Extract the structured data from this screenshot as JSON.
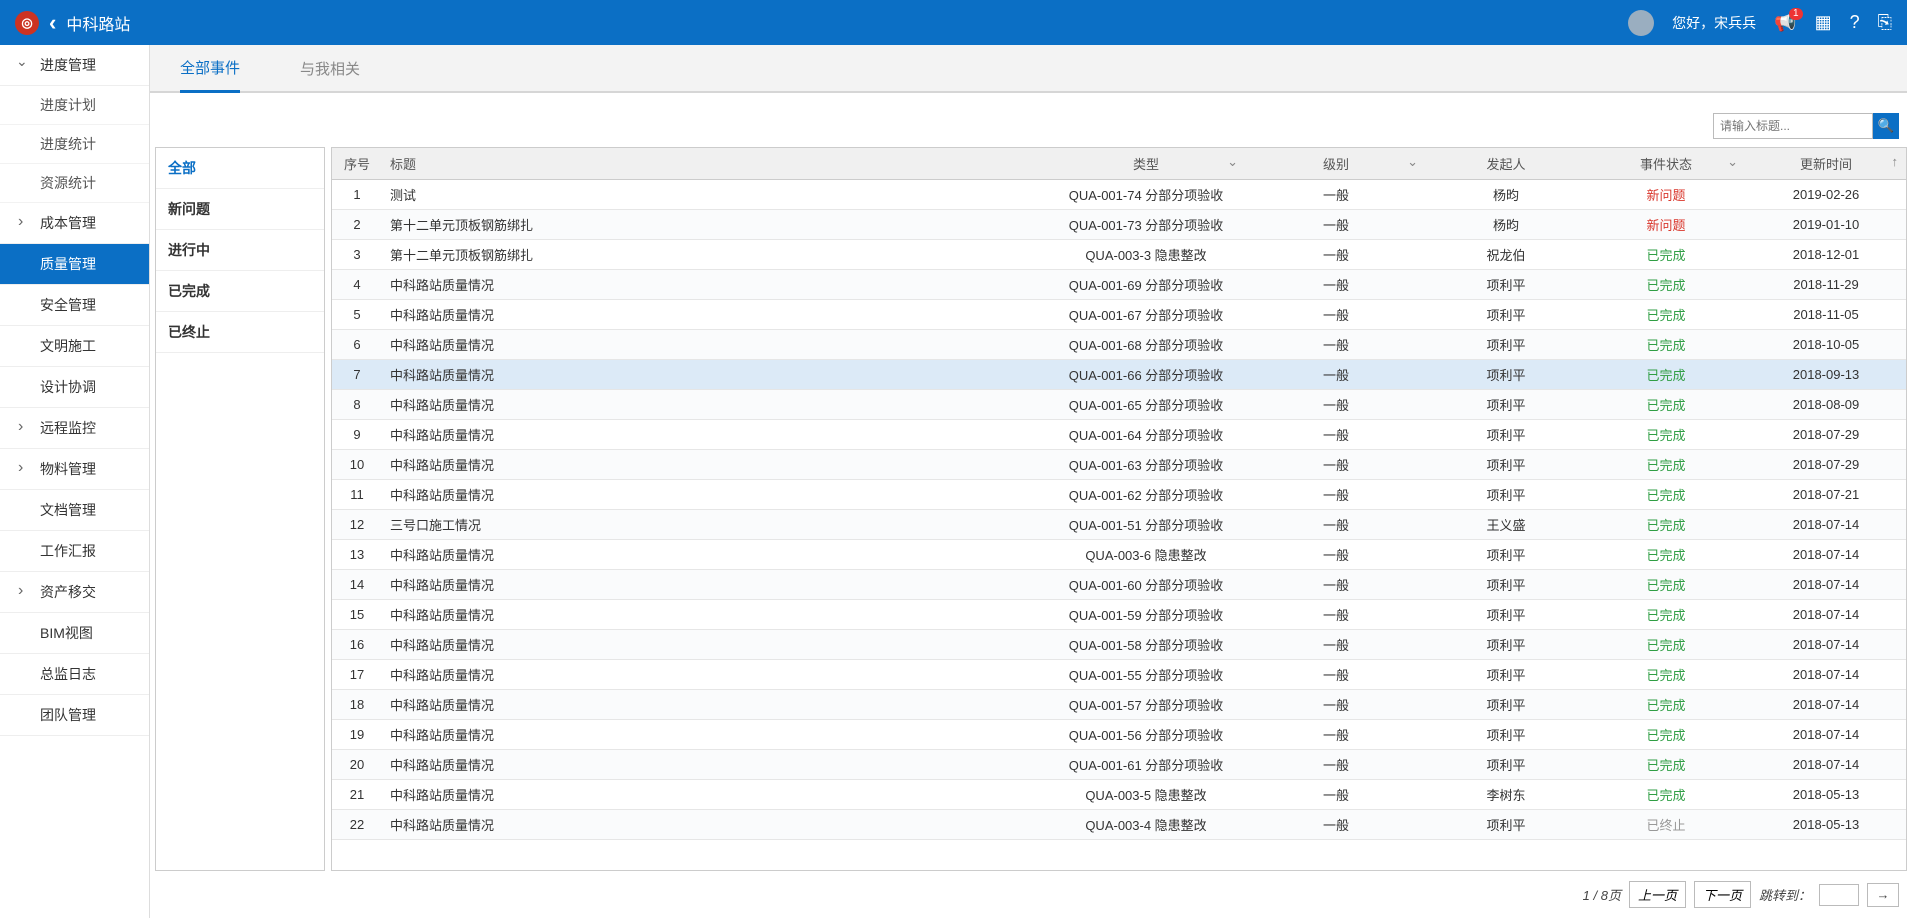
{
  "header": {
    "site_name": "中科路站",
    "greeting": "您好，宋兵兵",
    "badge_count": "1"
  },
  "sidebar": {
    "groups": [
      {
        "label": "进度管理",
        "expanded": true,
        "children": [
          {
            "label": "进度计划"
          },
          {
            "label": "进度统计"
          },
          {
            "label": "资源统计"
          }
        ]
      },
      {
        "label": "成本管理",
        "has_children": true
      },
      {
        "label": "质量管理",
        "active": true
      },
      {
        "label": "安全管理"
      },
      {
        "label": "文明施工"
      },
      {
        "label": "设计协调"
      },
      {
        "label": "远程监控",
        "has_children": true
      },
      {
        "label": "物料管理",
        "has_children": true
      },
      {
        "label": "文档管理"
      },
      {
        "label": "工作汇报"
      },
      {
        "label": "资产移交",
        "has_children": true
      },
      {
        "label": "BIM视图"
      },
      {
        "label": "总监日志"
      },
      {
        "label": "团队管理"
      }
    ]
  },
  "tabs": {
    "items": [
      {
        "label": "全部事件",
        "active": true
      },
      {
        "label": "与我相关"
      }
    ]
  },
  "search": {
    "placeholder": "请输入标题..."
  },
  "filters": {
    "items": [
      {
        "label": "全部",
        "active": true
      },
      {
        "label": "新问题"
      },
      {
        "label": "进行中"
      },
      {
        "label": "已完成"
      },
      {
        "label": "已终止"
      }
    ]
  },
  "table": {
    "headers": {
      "idx": "序号",
      "title": "标题",
      "type": "类型",
      "level": "级别",
      "owner": "发起人",
      "status": "事件状态",
      "time": "更新时间"
    },
    "rows": [
      {
        "idx": "1",
        "title": "测试",
        "type": "QUA-001-74 分部分项验收",
        "level": "一般",
        "owner": "杨昀",
        "status": "新问题",
        "status_class": "status-new",
        "time": "2019-02-26"
      },
      {
        "idx": "2",
        "title": "第十二单元顶板钢筋绑扎",
        "type": "QUA-001-73 分部分项验收",
        "level": "一般",
        "owner": "杨昀",
        "status": "新问题",
        "status_class": "status-new",
        "time": "2019-01-10"
      },
      {
        "idx": "3",
        "title": "第十二单元顶板钢筋绑扎",
        "type": "QUA-003-3 隐患整改",
        "level": "一般",
        "owner": "祝龙伯",
        "status": "已完成",
        "status_class": "status-done",
        "time": "2018-12-01"
      },
      {
        "idx": "4",
        "title": "中科路站质量情况",
        "type": "QUA-001-69 分部分项验收",
        "level": "一般",
        "owner": "项利平",
        "status": "已完成",
        "status_class": "status-done",
        "time": "2018-11-29"
      },
      {
        "idx": "5",
        "title": "中科路站质量情况",
        "type": "QUA-001-67 分部分项验收",
        "level": "一般",
        "owner": "项利平",
        "status": "已完成",
        "status_class": "status-done",
        "time": "2018-11-05"
      },
      {
        "idx": "6",
        "title": "中科路站质量情况",
        "type": "QUA-001-68 分部分项验收",
        "level": "一般",
        "owner": "项利平",
        "status": "已完成",
        "status_class": "status-done",
        "time": "2018-10-05"
      },
      {
        "idx": "7",
        "title": "中科路站质量情况",
        "type": "QUA-001-66 分部分项验收",
        "level": "一般",
        "owner": "项利平",
        "status": "已完成",
        "status_class": "status-done",
        "time": "2018-09-13",
        "hovered": true
      },
      {
        "idx": "8",
        "title": "中科路站质量情况",
        "type": "QUA-001-65 分部分项验收",
        "level": "一般",
        "owner": "项利平",
        "status": "已完成",
        "status_class": "status-done",
        "time": "2018-08-09"
      },
      {
        "idx": "9",
        "title": "中科路站质量情况",
        "type": "QUA-001-64 分部分项验收",
        "level": "一般",
        "owner": "项利平",
        "status": "已完成",
        "status_class": "status-done",
        "time": "2018-07-29"
      },
      {
        "idx": "10",
        "title": "中科路站质量情况",
        "type": "QUA-001-63 分部分项验收",
        "level": "一般",
        "owner": "项利平",
        "status": "已完成",
        "status_class": "status-done",
        "time": "2018-07-29"
      },
      {
        "idx": "11",
        "title": "中科路站质量情况",
        "type": "QUA-001-62 分部分项验收",
        "level": "一般",
        "owner": "项利平",
        "status": "已完成",
        "status_class": "status-done",
        "time": "2018-07-21"
      },
      {
        "idx": "12",
        "title": "三号口施工情况",
        "type": "QUA-001-51 分部分项验收",
        "level": "一般",
        "owner": "王义盛",
        "status": "已完成",
        "status_class": "status-done",
        "time": "2018-07-14"
      },
      {
        "idx": "13",
        "title": "中科路站质量情况",
        "type": "QUA-003-6 隐患整改",
        "level": "一般",
        "owner": "项利平",
        "status": "已完成",
        "status_class": "status-done",
        "time": "2018-07-14"
      },
      {
        "idx": "14",
        "title": "中科路站质量情况",
        "type": "QUA-001-60 分部分项验收",
        "level": "一般",
        "owner": "项利平",
        "status": "已完成",
        "status_class": "status-done",
        "time": "2018-07-14"
      },
      {
        "idx": "15",
        "title": "中科路站质量情况",
        "type": "QUA-001-59 分部分项验收",
        "level": "一般",
        "owner": "项利平",
        "status": "已完成",
        "status_class": "status-done",
        "time": "2018-07-14"
      },
      {
        "idx": "16",
        "title": "中科路站质量情况",
        "type": "QUA-001-58 分部分项验收",
        "level": "一般",
        "owner": "项利平",
        "status": "已完成",
        "status_class": "status-done",
        "time": "2018-07-14"
      },
      {
        "idx": "17",
        "title": "中科路站质量情况",
        "type": "QUA-001-55 分部分项验收",
        "level": "一般",
        "owner": "项利平",
        "status": "已完成",
        "status_class": "status-done",
        "time": "2018-07-14"
      },
      {
        "idx": "18",
        "title": "中科路站质量情况",
        "type": "QUA-001-57 分部分项验收",
        "level": "一般",
        "owner": "项利平",
        "status": "已完成",
        "status_class": "status-done",
        "time": "2018-07-14"
      },
      {
        "idx": "19",
        "title": "中科路站质量情况",
        "type": "QUA-001-56 分部分项验收",
        "level": "一般",
        "owner": "项利平",
        "status": "已完成",
        "status_class": "status-done",
        "time": "2018-07-14"
      },
      {
        "idx": "20",
        "title": "中科路站质量情况",
        "type": "QUA-001-61 分部分项验收",
        "level": "一般",
        "owner": "项利平",
        "status": "已完成",
        "status_class": "status-done",
        "time": "2018-07-14"
      },
      {
        "idx": "21",
        "title": "中科路站质量情况",
        "type": "QUA-003-5 隐患整改",
        "level": "一般",
        "owner": "李树东",
        "status": "已完成",
        "status_class": "status-done",
        "time": "2018-05-13"
      },
      {
        "idx": "22",
        "title": "中科路站质量情况",
        "type": "QUA-003-4 隐患整改",
        "level": "一般",
        "owner": "项利平",
        "status": "已终止",
        "status_class": "status-end",
        "time": "2018-05-13"
      }
    ]
  },
  "pager": {
    "page_info": "1 / 8页",
    "prev": "上一页",
    "next": "下一页",
    "jump_label": "跳转到："
  }
}
